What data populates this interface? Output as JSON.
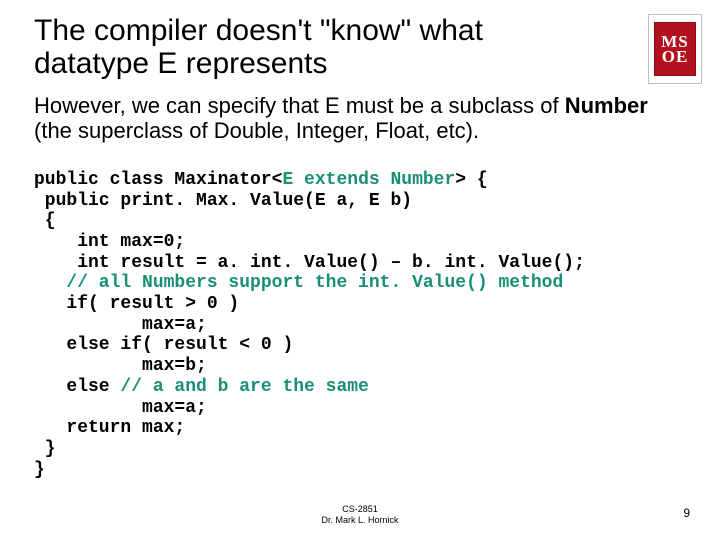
{
  "title": "The compiler doesn't \"know\" what datatype E represents",
  "subtitle_parts": {
    "p1": "However, we can specify that E must be a subclass of ",
    "bold": "Number",
    "p2": " (the superclass of Double, Integer, Float, etc)."
  },
  "code": {
    "l1a": "public class Maxinator<",
    "l1b": "E extends Number",
    "l1c": "> {",
    "l2": " public print. Max. Value(E a, E b)",
    "l3": " {",
    "l4": "    int max=0;",
    "l5": "    int result = a. int. Value() – b. int. Value();",
    "l6a": "   ",
    "l6b": "// all Numbers support the int. Value() method",
    "l7": "   if( result > 0 )",
    "l8": "          max=a;",
    "l9": "   else if( result < 0 )",
    "l10": "          max=b;",
    "l11a": "   else ",
    "l11b": "// a and b are the same",
    "l12": "          max=a;",
    "l13": "   return max;",
    "l14": " }",
    "l15": "}"
  },
  "logo": {
    "line1": "MS",
    "line2": "OE"
  },
  "footer": {
    "course": "CS-2851",
    "author": "Dr. Mark L. Hornick"
  },
  "page_number": "9"
}
